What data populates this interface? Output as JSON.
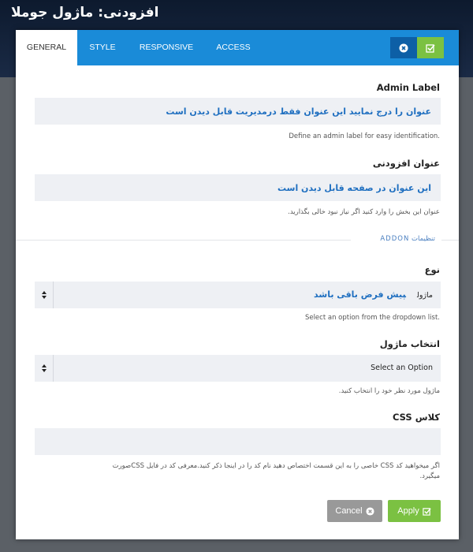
{
  "backdrop": {
    "title": "افزودنی: ماژول جوملا"
  },
  "tabs": [
    {
      "label": "GENERAL"
    },
    {
      "label": "STYLE"
    },
    {
      "label": "RESPONSIVE"
    },
    {
      "label": "ACCESS"
    }
  ],
  "fields": {
    "admin_label": {
      "label": "Admin Label",
      "value": "عنوان را درج نمایید این عنوان فقط درمدیریت قابل دیدن است",
      "help": "Define an admin label for easy identification."
    },
    "addon_title": {
      "label": "عنوان افزودنی",
      "value": "این عنوان در صفحه قابل دیدن است",
      "help": "عنوان این بخش را وارد کنید اگر نیاز نبود خالی بگذارید."
    },
    "divider": "تنظیمات ADDON",
    "type": {
      "label": "نوع",
      "selected": "ماژول",
      "note": "پیش فرض باقی باشد",
      "help": "Select an option from the dropdown list."
    },
    "module_select": {
      "label": "انتخاب ماژول",
      "selected": "Select an Option",
      "help": "ماژول مورد نظر خود را انتخاب کنید."
    },
    "css_class": {
      "label": "کلاس CSS",
      "value": "",
      "help_line1": "اگر میخواهید کد CSS خاصی را به این قسمت اختصاص دهید نام کد را در اینجا ذکر کنید.معرفی کد در فایل CSSصورت",
      "help_line2": "میگیرد."
    }
  },
  "buttons": {
    "cancel": "Cancel",
    "apply": "Apply"
  },
  "colors": {
    "header_blue": "#1a8bd8",
    "apply_green": "#7bc142",
    "cancel_gray": "#999999",
    "input_bg": "#eef0f4",
    "value_blue": "#1f6fc0"
  }
}
